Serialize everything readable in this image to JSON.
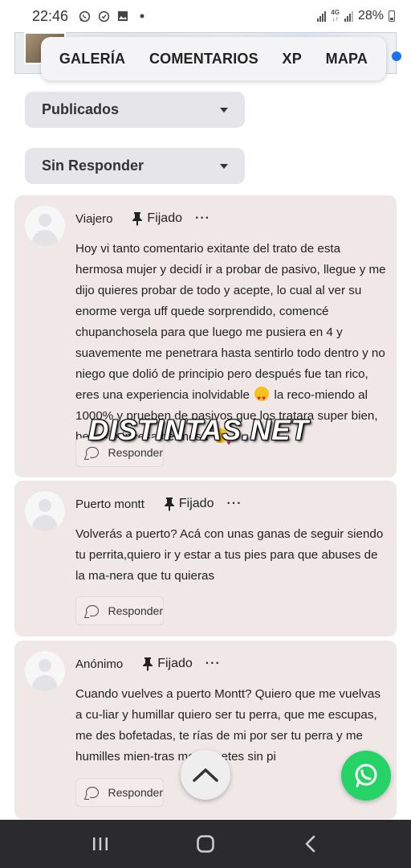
{
  "status_bar": {
    "time": "22:46",
    "network": "4G",
    "battery": "28%"
  },
  "tabs": [
    "GALERÍA",
    "COMENTARIOS",
    "XP",
    "MAPA"
  ],
  "filters": {
    "status": "Publicados",
    "response": "Sin Responder"
  },
  "comments": [
    {
      "author": "Viajero",
      "pinned_label": "Fijado",
      "more": "···",
      "text_parts": [
        "Hoy vi tanto comentario exitante del trato de esta hermosa mujer y decidí ir a probar de pasivo, llegue y me dijo quieres probar de todo y acepte, lo cual al ver su enorme verga uff quede sorprendido, comencé chupanchosela para que luego me pusiera en 4 y suavemente me penetrara hasta sentirlo todo dentro y no niego que dolió de principio pero después fue tan rico, eres una experiencia inolvidable",
        "la reco-miendo al 1000% y prueben de pasivos que los tratara super bien, besos princesa hermosa"
      ],
      "reply_label": "Responder"
    },
    {
      "author": "Puerto montt",
      "pinned_label": "Fijado",
      "more": "···",
      "text": "Volverás a puerto? Acá con unas ganas de seguir siendo tu perrita,quiero ir y estar a tus pies para que abuses de la ma-nera que tu quieras",
      "reply_label": "Responder"
    },
    {
      "author": "Anónimo",
      "pinned_label": "Fijado",
      "more": "···",
      "text": "Cuando vuelves a puerto Montt? Quiero que me vuelvas a cu-liar y humillar quiero ser tu perra, que me escupas, me des bofetadas, te rías de mi por ser tu perra y me humilles mien-tras me la metes sin pi",
      "reply_label": "Responder"
    }
  ],
  "watermark": "DISTINTAS.NET",
  "icons": {
    "pin": "pin-icon",
    "reply": "chat-bubble-icon",
    "scroll_top": "chevron-up-icon",
    "whatsapp": "whatsapp-icon",
    "nav": [
      "recents-icon",
      "home-icon",
      "back-icon"
    ]
  },
  "colors": {
    "card_bg": "#f0e7e7",
    "dropdown_bg": "#e6e6ea",
    "whatsapp": "#25d366",
    "nav_bar": "#2b2b2e"
  }
}
